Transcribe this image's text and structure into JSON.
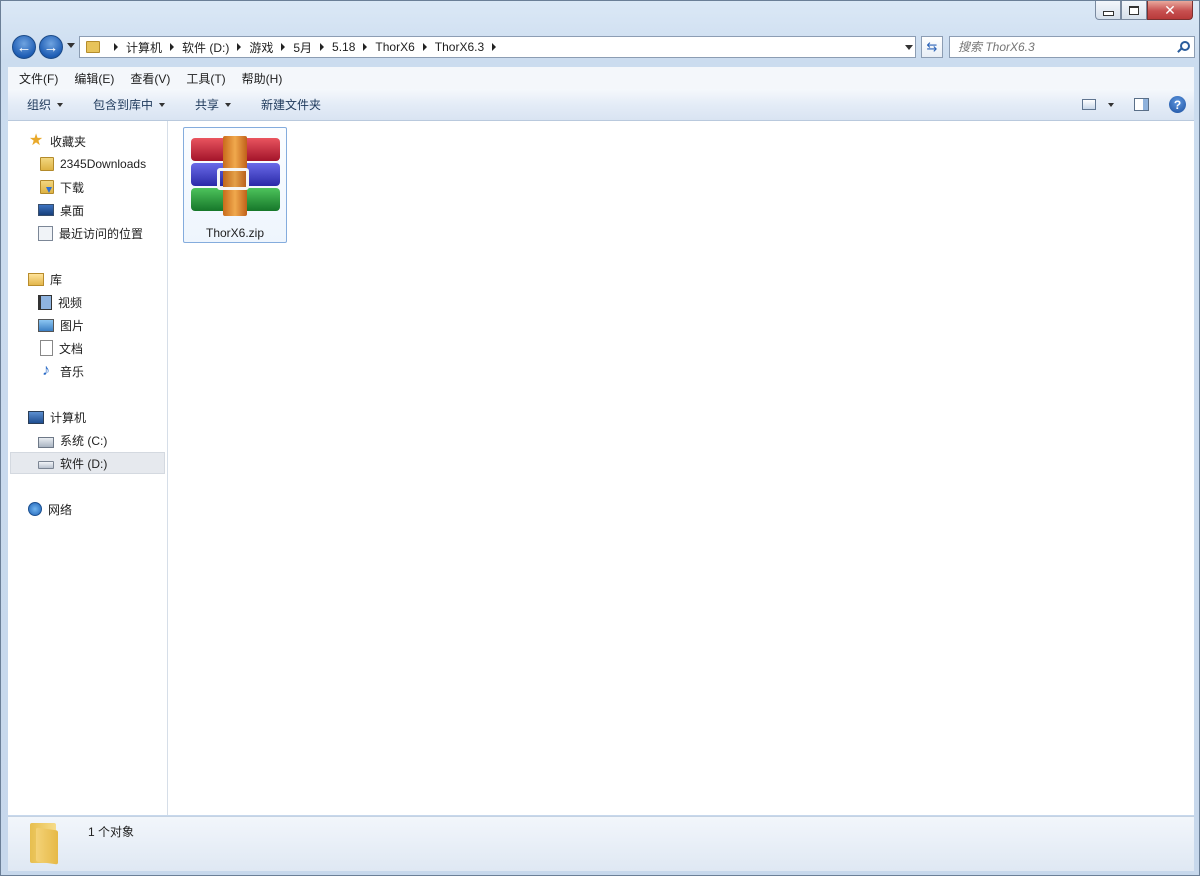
{
  "window": {
    "caption_buttons": {
      "minimize": "minimize",
      "maximize": "maximize",
      "close": "close"
    }
  },
  "navigation": {
    "back": "back",
    "forward": "forward",
    "breadcrumbs": [
      "计算机",
      "软件 (D:)",
      "游戏",
      "5月",
      "5.18",
      "ThorX6",
      "ThorX6.3"
    ]
  },
  "search": {
    "placeholder": "搜索 ThorX6.3"
  },
  "menu": [
    "文件(F)",
    "编辑(E)",
    "查看(V)",
    "工具(T)",
    "帮助(H)"
  ],
  "commands": {
    "organize": "组织",
    "include_in_library": "包含到库中",
    "share": "共享",
    "new_folder": "新建文件夹"
  },
  "sidebar": {
    "favorites": {
      "label": "收藏夹",
      "items": [
        "2345Downloads",
        "下载",
        "桌面",
        "最近访问的位置"
      ]
    },
    "libraries": {
      "label": "库",
      "items": [
        "视频",
        "图片",
        "文档",
        "音乐"
      ]
    },
    "computer": {
      "label": "计算机",
      "items": [
        "系统 (C:)",
        "软件 (D:)"
      ],
      "selected": "软件 (D:)"
    },
    "network": {
      "label": "网络"
    }
  },
  "files": [
    {
      "name": "ThorX6.zip",
      "icon": "winrar-archive-icon"
    }
  ],
  "status": {
    "count_text": "1 个对象"
  }
}
